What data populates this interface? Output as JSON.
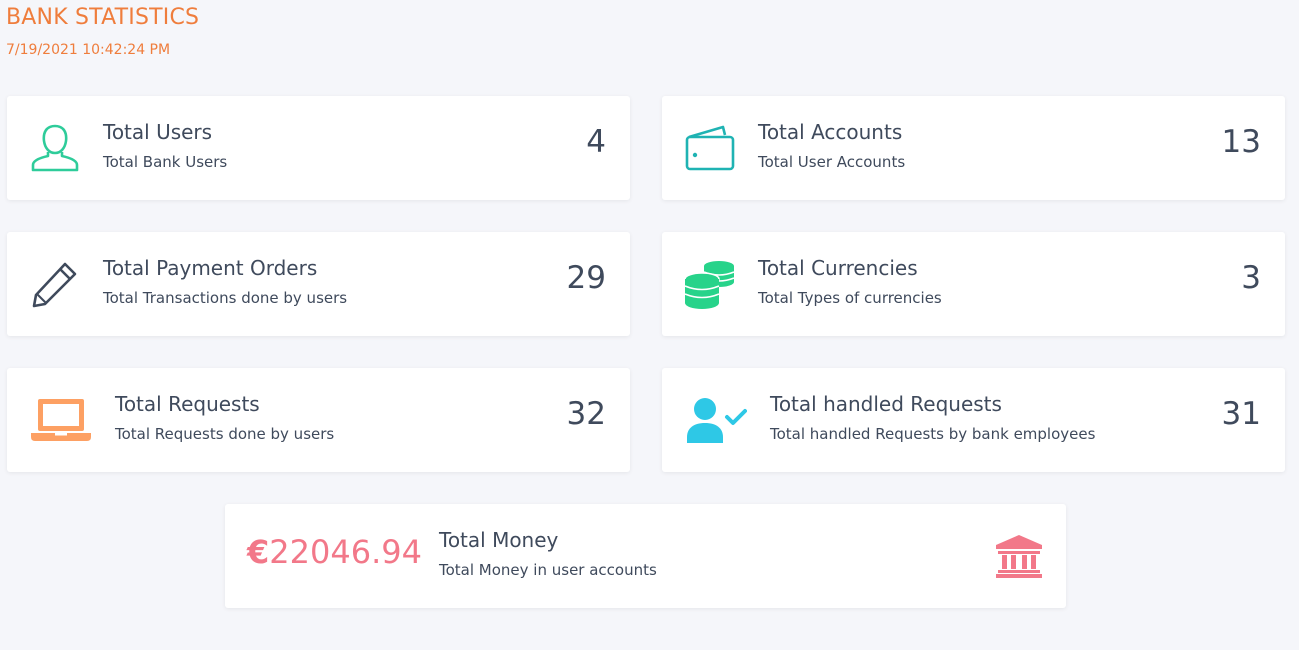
{
  "page": {
    "title": "BANK STATISTICS",
    "datetime": "7/19/2021 10:42:24 PM"
  },
  "colors": {
    "accent_orange": "#ef7d3c",
    "teal_green": "#2ecc9a",
    "teal": "#1fb3b3",
    "dark_icon": "#3f4a5c",
    "green": "#27d38a",
    "orange_icon": "#fda063",
    "cyan": "#2ec8e6",
    "pink": "#f27889"
  },
  "cards": {
    "users": {
      "title": "Total Users",
      "subtitle": "Total Bank Users",
      "value": "4",
      "icon": "user-outline-icon"
    },
    "accounts": {
      "title": "Total Accounts",
      "subtitle": "Total User Accounts",
      "value": "13",
      "icon": "wallet-icon"
    },
    "payment_orders": {
      "title": "Total Payment Orders",
      "subtitle": "Total Transactions done by users",
      "value": "29",
      "icon": "pencil-icon"
    },
    "currencies": {
      "title": "Total Currencies",
      "subtitle": "Total Types of currencies",
      "value": "3",
      "icon": "coins-icon"
    },
    "requests": {
      "title": "Total Requests",
      "subtitle": "Total Requests done by users",
      "value": "32",
      "icon": "laptop-icon"
    },
    "handled_requests": {
      "title": "Total handled Requests",
      "subtitle": "Total handled Requests by bank employees",
      "value": "31",
      "icon": "user-check-icon"
    }
  },
  "money": {
    "currency_symbol": "€",
    "amount": "22046.94",
    "title": "Total Money",
    "subtitle": "Total Money in user accounts",
    "icon": "bank-icon"
  }
}
